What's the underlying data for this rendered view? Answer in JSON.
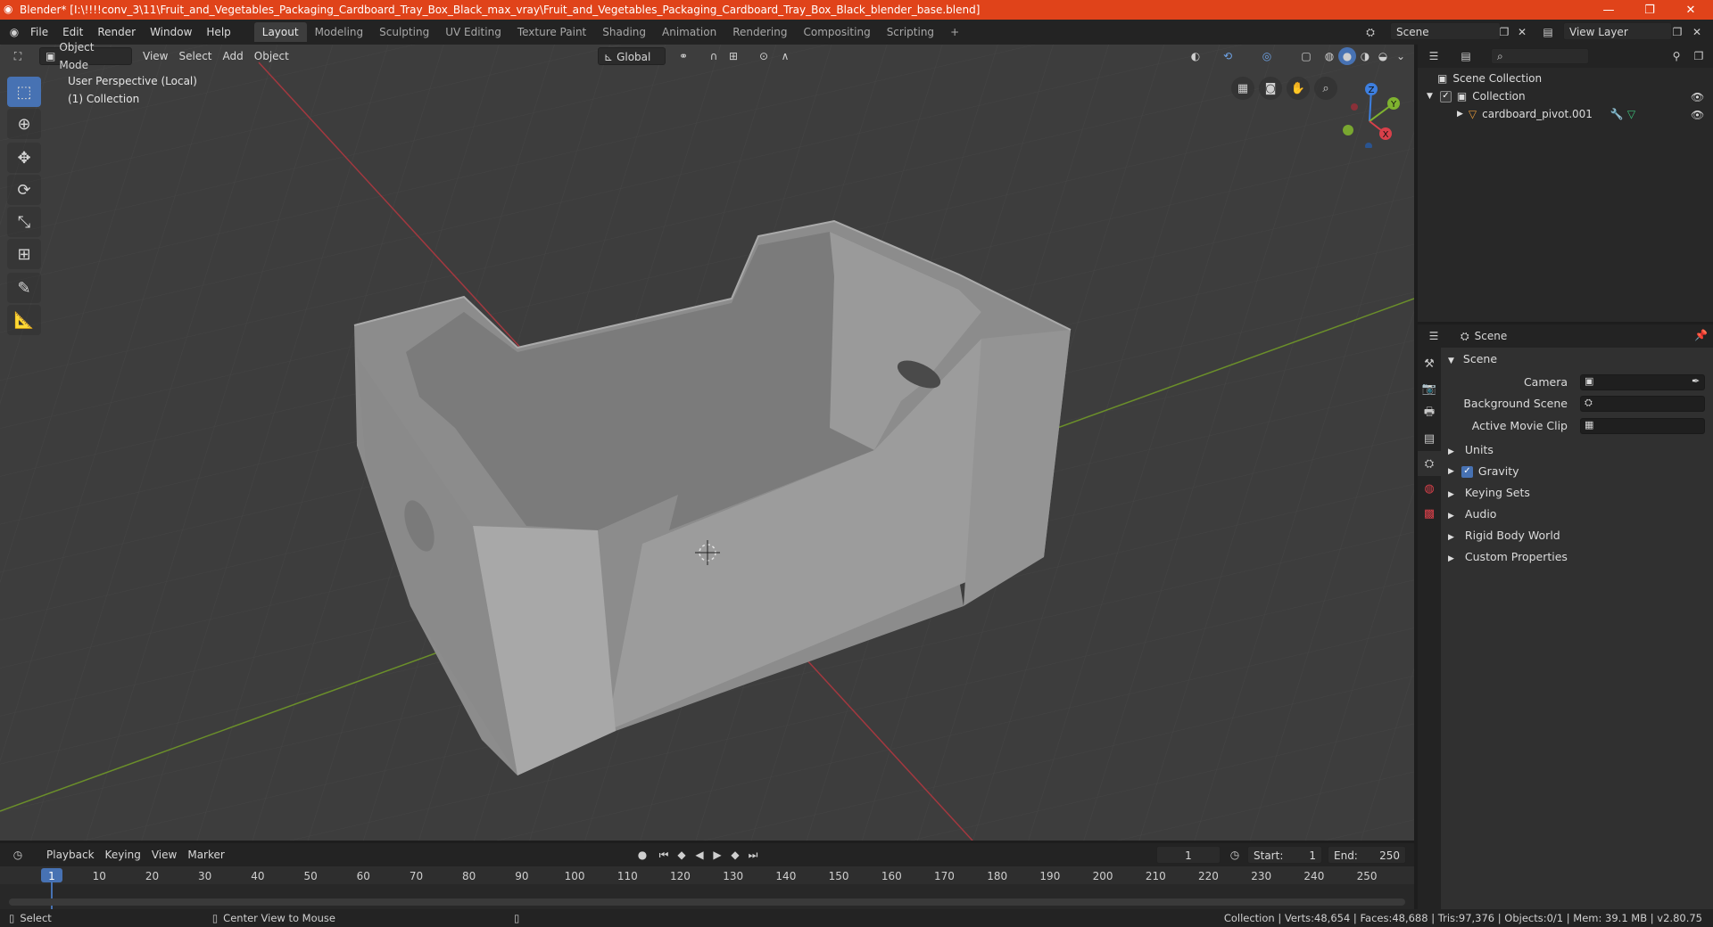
{
  "window": {
    "title": "Blender* [I:\\!!!!conv_3\\11\\Fruit_and_Vegetables_Packaging_Cardboard_Tray_Box_Black_max_vray\\Fruit_and_Vegetables_Packaging_Cardboard_Tray_Box_Black_blender_base.blend]",
    "minimize": "—",
    "maximize": "❐",
    "close": "✕"
  },
  "menu": [
    "File",
    "Edit",
    "Render",
    "Window",
    "Help"
  ],
  "workspaces": [
    {
      "label": "Layout",
      "active": true
    },
    {
      "label": "Modeling"
    },
    {
      "label": "Sculpting"
    },
    {
      "label": "UV Editing"
    },
    {
      "label": "Texture Paint"
    },
    {
      "label": "Shading"
    },
    {
      "label": "Animation"
    },
    {
      "label": "Rendering"
    },
    {
      "label": "Compositing"
    },
    {
      "label": "Scripting"
    }
  ],
  "add_workspace": "+",
  "scene_selector": "Scene",
  "view_layer": "View Layer",
  "viewport_header": {
    "mode": "Object Mode",
    "menus": [
      "View",
      "Select",
      "Add",
      "Object"
    ],
    "transform_orientation": "Global"
  },
  "viewport": {
    "perspective_label": "User Perspective (Local)",
    "collection_label": "(1) Collection",
    "gizmo": {
      "x": "X",
      "y": "Y",
      "z": "Z"
    }
  },
  "outliner": {
    "scene_collection": "Scene Collection",
    "collection": "Collection",
    "object": "cardboard_pivot.001",
    "search_placeholder": ""
  },
  "properties": {
    "header": "Scene",
    "panel_title": "Scene",
    "camera_label": "Camera",
    "background_scene_label": "Background Scene",
    "active_movie_clip_label": "Active Movie Clip",
    "sections": [
      "Units",
      "Gravity",
      "Keying Sets",
      "Audio",
      "Rigid Body World",
      "Custom Properties"
    ],
    "gravity_checked": true
  },
  "timeline": {
    "menus": [
      "Playback",
      "Keying",
      "View",
      "Marker"
    ],
    "current_frame": "1",
    "start_label": "Start:",
    "start": "1",
    "end_label": "End:",
    "end": "250",
    "ticks": [
      "1",
      "10",
      "20",
      "30",
      "40",
      "50",
      "60",
      "70",
      "80",
      "90",
      "100",
      "110",
      "120",
      "130",
      "140",
      "150",
      "160",
      "170",
      "180",
      "190",
      "200",
      "210",
      "220",
      "230",
      "240",
      "250"
    ]
  },
  "statusbar": {
    "select": "Select",
    "center_view": "Center View to Mouse",
    "stats": "Collection | Verts:48,654 | Faces:48,688 | Tris:97,376 | Objects:0/1 | Mem: 39.1 MB | v2.80.75"
  },
  "colors": {
    "titlebar": "#e0431a",
    "accent": "#4772b3",
    "viewport_bg": "#3d3d3d",
    "x_axis": "#d8404a",
    "y_axis": "#7fb32f",
    "z_axis": "#3d7fe0"
  }
}
